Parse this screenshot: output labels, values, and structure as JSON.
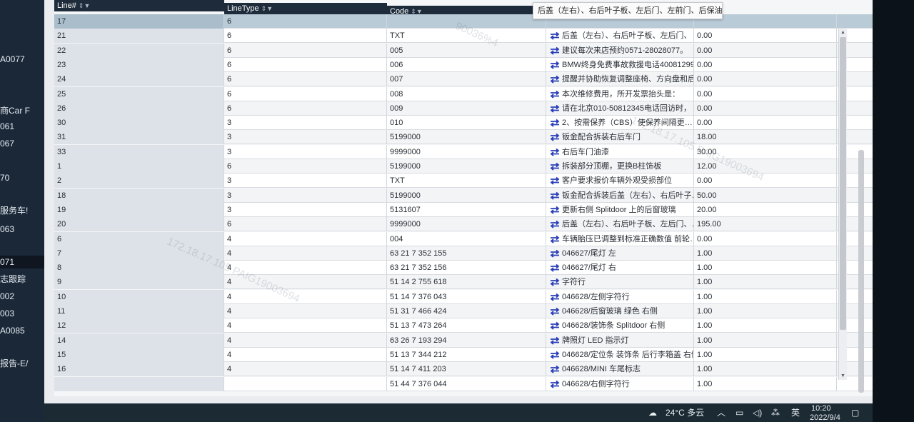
{
  "left_strip": [
    "A0077",
    "商Car F",
    "061",
    "067",
    "70",
    "服务车!",
    "063",
    "071",
    "志跟踪",
    "002",
    "003",
    "A0085",
    "报告-E/"
  ],
  "columns": [
    "Line#",
    "LineType",
    "Code",
    "",
    ""
  ],
  "tooltip": "后盖（左右）、右后叶子板、左后门、左前门、后保油漆",
  "rows": [
    {
      "line": "17",
      "type": "6",
      "code": "",
      "desc": "",
      "qty": ""
    },
    {
      "line": "21",
      "type": "6",
      "code": "TXT",
      "desc": "后盖（左右）、右后叶子板、左后门、",
      "qty": "0.00"
    },
    {
      "line": "22",
      "type": "6",
      "code": "005",
      "desc": "建议每次来店预约0571-28028077。",
      "qty": "0.00"
    },
    {
      "line": "23",
      "type": "6",
      "code": "006",
      "desc": "BMW终身免费事故救援电话40081299…",
      "qty": "0.00"
    },
    {
      "line": "24",
      "type": "6",
      "code": "007",
      "desc": "提醒并协助恢复调整座椅、方向盘和后…",
      "qty": "0.00"
    },
    {
      "line": "25",
      "type": "6",
      "code": "008",
      "desc": "本次维修费用，所开发票抬头是：",
      "qty": "0.00"
    },
    {
      "line": "26",
      "type": "6",
      "code": "009",
      "desc": "请在北京010-50812345电话回访时，",
      "qty": "0.00"
    },
    {
      "line": "30",
      "type": "3",
      "code": "010",
      "desc": "2、按需保养（CBS）使保养间隔更…",
      "qty": "0.00"
    },
    {
      "line": "31",
      "type": "3",
      "code": "5199000",
      "desc": "钣金配合拆装右后车门",
      "qty": "18.00"
    },
    {
      "line": "33",
      "type": "3",
      "code": "9999000",
      "desc": "右后车门油漆",
      "qty": "30.00"
    },
    {
      "line": "1",
      "type": "6",
      "code": "5199000",
      "desc": "拆装部分顶棚，更换B柱饰板",
      "qty": "12.00"
    },
    {
      "line": "2",
      "type": "3",
      "code": "TXT",
      "desc": "客户要求报价车辆外观受损部位",
      "qty": "0.00"
    },
    {
      "line": "18",
      "type": "3",
      "code": "5199000",
      "desc": "钣金配合拆装后盖（左右）、右后叶子…",
      "qty": "50.00"
    },
    {
      "line": "19",
      "type": "3",
      "code": "5131607",
      "desc": "更新右侧 Splitdoor 上的后窗玻璃",
      "qty": "20.00"
    },
    {
      "line": "20",
      "type": "6",
      "code": "9999000",
      "desc": "后盖（左右）、右后叶子板、左后门、…",
      "qty": "195.00"
    },
    {
      "line": "6",
      "type": "4",
      "code": "004",
      "desc": "车辆胎压已调整到标准正确数值 前轮…",
      "qty": "0.00"
    },
    {
      "line": "7",
      "type": "4",
      "code": "63 21 7 352 155",
      "desc": "046627/尾灯 左",
      "qty": "1.00"
    },
    {
      "line": "8",
      "type": "4",
      "code": "63 21 7 352 156",
      "desc": "046627/尾灯 右",
      "qty": "1.00"
    },
    {
      "line": "9",
      "type": "4",
      "code": "51 14 2 755 618",
      "desc": "字符行",
      "qty": "1.00"
    },
    {
      "line": "10",
      "type": "4",
      "code": "51 14 7 376 043",
      "desc": "046628/左侧字符行",
      "qty": "1.00"
    },
    {
      "line": "11",
      "type": "4",
      "code": "51 31 7 466 424",
      "desc": "046628/后窗玻璃 绿色 右侧",
      "qty": "1.00"
    },
    {
      "line": "12",
      "type": "4",
      "code": "51 13 7 473 264",
      "desc": "046628/装饰条 Splitdoor 右侧",
      "qty": "1.00"
    },
    {
      "line": "14",
      "type": "4",
      "code": "63 26 7 193 294",
      "desc": "牌照灯 LED 指示灯",
      "qty": "1.00"
    },
    {
      "line": "15",
      "type": "4",
      "code": "51 13 7 344 212",
      "desc": "046628/定位条 装饰条 后行李箱盖 右侧",
      "qty": "1.00"
    },
    {
      "line": "16",
      "type": "4",
      "code": "51 14 7 411 203",
      "desc": "046628/MINI 车尾标志",
      "qty": "1.00"
    },
    {
      "line": "",
      "type": "",
      "code": "51 44 7 376 044",
      "desc": "046628/右侧字符行",
      "qty": "1.00"
    }
  ],
  "watermarks": [
    "172.18.17.105  PAIG19003694",
    "172.18.17.105  PAIG19003694",
    "90036%4"
  ],
  "taskbar": {
    "weather": "24°C 多云",
    "ime": "英",
    "time": "10:20",
    "date": "2022/9/4"
  },
  "colors": {
    "header": "#1d2b3a",
    "selected_row": "#b9cbd6",
    "swap_icon": "#2a3fb8"
  }
}
